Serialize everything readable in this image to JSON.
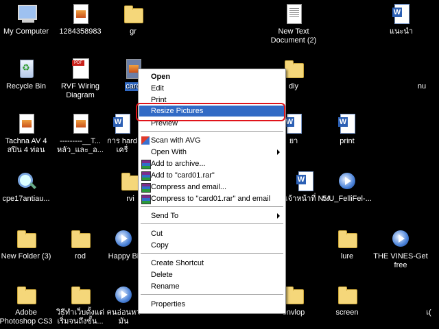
{
  "desktop": {
    "icons": [
      {
        "id": "my-computer",
        "label": "My Computer"
      },
      {
        "id": "file-1284",
        "label": "1284358983"
      },
      {
        "id": "gr",
        "label": "gr"
      },
      {
        "id": "new-text",
        "label": "New Text Document (2)"
      },
      {
        "id": "naenam",
        "label": "แนะนำ"
      },
      {
        "id": "recycle",
        "label": "Recycle Bin"
      },
      {
        "id": "rvf",
        "label": "RVF Wiring Diagram"
      },
      {
        "id": "card01",
        "label": "card"
      },
      {
        "id": "diy",
        "label": "diy"
      },
      {
        "id": "nu",
        "label": "nu"
      },
      {
        "id": "tachna",
        "label": "Tachna AV 4 สปิน 4 ท่อน"
      },
      {
        "id": "dashes",
        "label": "---------__T... หลัว_และ_อ..."
      },
      {
        "id": "kan-har",
        "label": "การ hard เครื่"
      },
      {
        "id": "ya",
        "label": "ยา"
      },
      {
        "id": "print",
        "label": "print"
      },
      {
        "id": "cpe",
        "label": "cpe17antiau..."
      },
      {
        "id": "rvi",
        "label": "rvi"
      },
      {
        "id": "oc-nm",
        "label": "อเจ้าหน้าที่ NM"
      },
      {
        "id": "fellifel",
        "label": "5.U_FelliFel-..."
      },
      {
        "id": "new-folder3",
        "label": "New Folder (3)"
      },
      {
        "id": "rod",
        "label": "rod"
      },
      {
        "id": "happy",
        "label": "Happy Bi"
      },
      {
        "id": "lure",
        "label": "lure"
      },
      {
        "id": "vines",
        "label": "THE VINES-Get free"
      },
      {
        "id": "adobe",
        "label": "Adobe Photoshop CS3"
      },
      {
        "id": "thai-win",
        "label": "วิธีทำเว็บตั้งแต่ เริ่มจนถึงขั้น..."
      },
      {
        "id": "thai-ni",
        "label": "คนอ่อนหา มัน"
      },
      {
        "id": "envlop",
        "label": "envlop"
      },
      {
        "id": "screen",
        "label": "screen"
      },
      {
        "id": "edge-r",
        "label": "เ("
      }
    ]
  },
  "context_menu": {
    "open": "Open",
    "edit": "Edit",
    "print": "Print",
    "resize": "Resize Pictures",
    "preview": "Preview",
    "scan": "Scan with AVG",
    "open_with": "Open With",
    "add_archive": "Add to archive...",
    "add_rar": "Add to \"card01.rar\"",
    "compress_email": "Compress and email...",
    "compress_rar_email": "Compress to \"card01.rar\" and email",
    "send_to": "Send To",
    "cut": "Cut",
    "copy": "Copy",
    "create_shortcut": "Create Shortcut",
    "delete": "Delete",
    "rename": "Rename",
    "properties": "Properties"
  },
  "colors": {
    "highlight": "#316ac5",
    "annotation_ring": "#e0141a",
    "desktop_bg": "#000000"
  }
}
